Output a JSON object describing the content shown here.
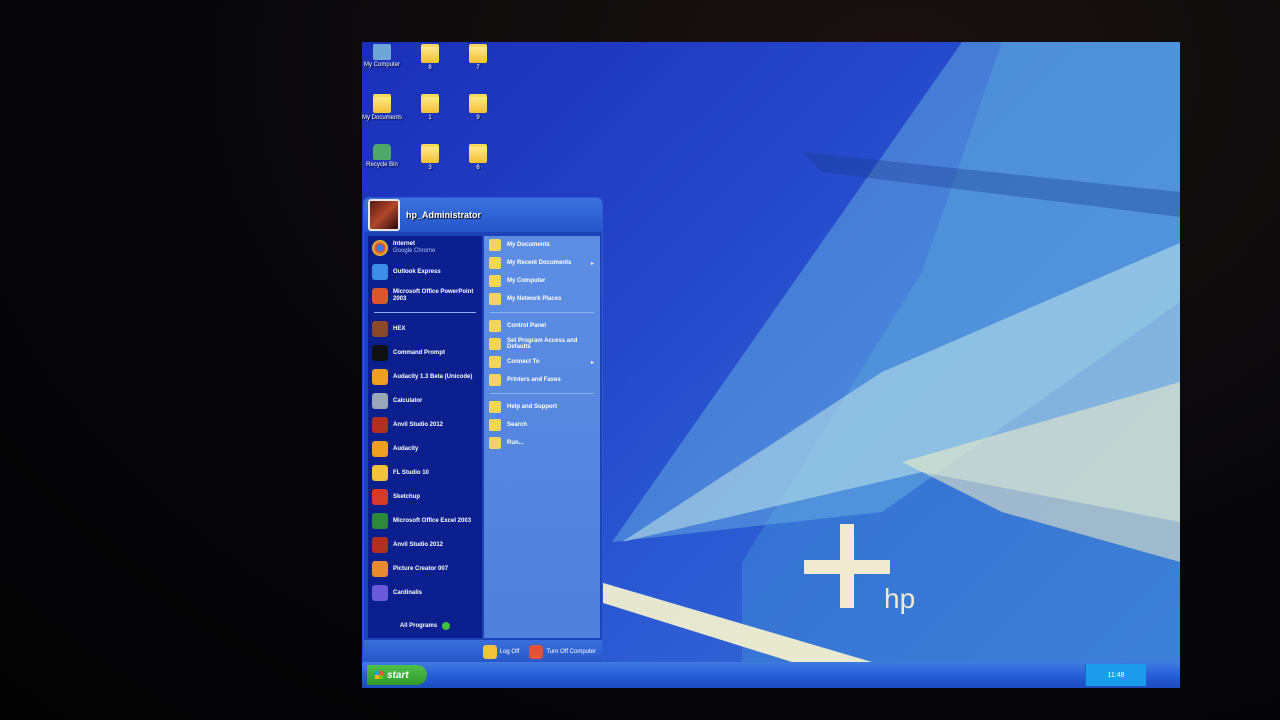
{
  "desktop": {
    "icons": [
      {
        "label": "My Computer",
        "icon": "computer-icon"
      },
      {
        "label": "8",
        "icon": "folder-icon"
      },
      {
        "label": "7",
        "icon": "folder-icon"
      },
      {
        "label": "My Documents",
        "icon": "documents-icon"
      },
      {
        "label": "1",
        "icon": "folder-icon"
      },
      {
        "label": "9",
        "icon": "folder-icon"
      },
      {
        "label": "Recycle Bin",
        "icon": "recycle-bin-icon"
      },
      {
        "label": "3",
        "icon": "folder-icon"
      },
      {
        "label": "6",
        "icon": "folder-icon"
      }
    ],
    "wallpaper_brand": "hp"
  },
  "start_menu": {
    "user_name": "hp_Administrator",
    "pinned": [
      {
        "label": "Internet",
        "sub": "Google Chrome",
        "icon": "chrome-icon",
        "color": "#d9412f"
      },
      {
        "label": "Outlook Express",
        "sub": "",
        "icon": "outlook-express-icon",
        "color": "#3d8ee8"
      },
      {
        "label": "Microsoft Office PowerPoint 2003",
        "sub": "",
        "icon": "powerpoint-icon",
        "color": "#d9572a"
      }
    ],
    "recent": [
      {
        "label": "HEX",
        "icon": "hex-icon",
        "color": "#8a4a2a"
      },
      {
        "label": "Command Prompt",
        "icon": "command-prompt-icon",
        "color": "#111111"
      },
      {
        "label": "Audacity 1.3 Beta (Unicode)",
        "icon": "audacity-icon",
        "color": "#f0a020"
      },
      {
        "label": "Calculator",
        "icon": "calculator-icon",
        "color": "#9aa7b8"
      },
      {
        "label": "Anvil Studio 2012",
        "icon": "anvil-studio-icon",
        "color": "#b03020"
      },
      {
        "label": "Audacity",
        "icon": "audacity-icon",
        "color": "#f0a020"
      },
      {
        "label": "FL Studio 10",
        "icon": "fl-studio-icon",
        "color": "#f2c23a"
      },
      {
        "label": "Sketchup",
        "icon": "sketchup-icon",
        "color": "#d83a2a"
      },
      {
        "label": "Microsoft Office Excel 2003",
        "icon": "excel-icon",
        "color": "#2e8a3a"
      },
      {
        "label": "Anvil Studio 2012",
        "icon": "anvil-studio-icon",
        "color": "#b03020"
      },
      {
        "label": "Picture Creator 007",
        "icon": "picture-creator-icon",
        "color": "#e88a30"
      },
      {
        "label": "Cardinalis",
        "icon": "cardinalis-icon",
        "color": "#6a5adb"
      }
    ],
    "all_programs": "All Programs",
    "right_places": [
      {
        "label": "My Documents",
        "icon": "documents-folder-icon",
        "arrow": ""
      },
      {
        "label": "My Recent Documents",
        "icon": "recent-documents-icon",
        "arrow": "▸"
      },
      {
        "label": "My Computer",
        "icon": "computer-icon",
        "arrow": ""
      },
      {
        "label": "My Network Places",
        "icon": "network-places-icon",
        "arrow": ""
      }
    ],
    "right_system": [
      {
        "label": "Control Panel",
        "icon": "control-panel-icon",
        "arrow": ""
      },
      {
        "label": "Set Program Access and Defaults",
        "icon": "program-access-icon",
        "arrow": ""
      },
      {
        "label": "Connect To",
        "icon": "connect-to-icon",
        "arrow": "▸"
      },
      {
        "label": "Printers and Faxes",
        "icon": "printers-icon",
        "arrow": ""
      }
    ],
    "right_help": [
      {
        "label": "Help and Support",
        "icon": "help-icon",
        "arrow": ""
      },
      {
        "label": "Search",
        "icon": "search-icon",
        "arrow": ""
      },
      {
        "label": "Run...",
        "icon": "run-icon",
        "arrow": ""
      }
    ],
    "footer": {
      "log_off": "Log Off",
      "turn_off": "Turn Off Computer"
    }
  },
  "taskbar": {
    "start_label": "start",
    "clock": "11:48"
  }
}
